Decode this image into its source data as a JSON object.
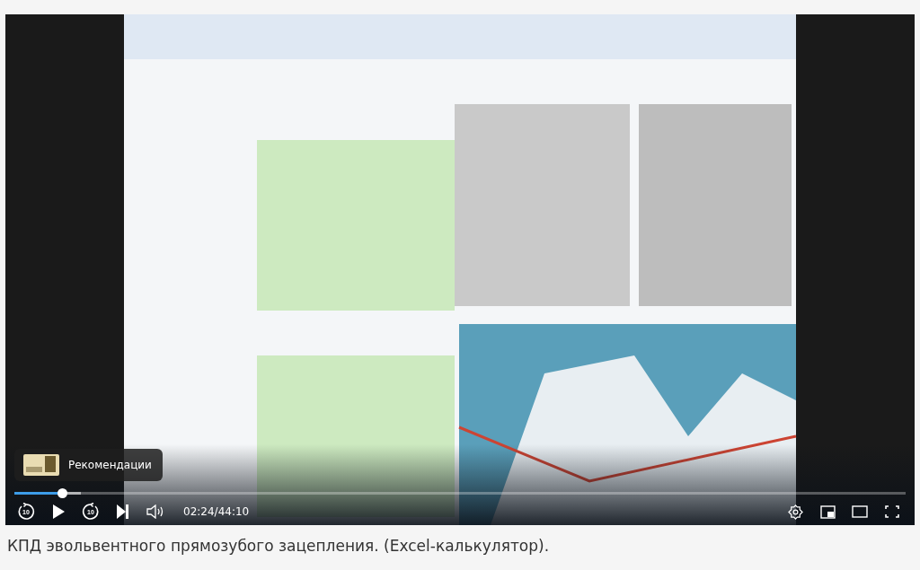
{
  "player": {
    "recommendations": {
      "label": "Рекомендации"
    },
    "progress": {
      "level": 0.053
    },
    "controls": {
      "rewind_label": "10",
      "forward_label": "10",
      "playing": false,
      "time": "02:24/44:10"
    }
  },
  "caption": "КПД эвольвентного прямозубого зацепления. (Excel-калькулятор)."
}
